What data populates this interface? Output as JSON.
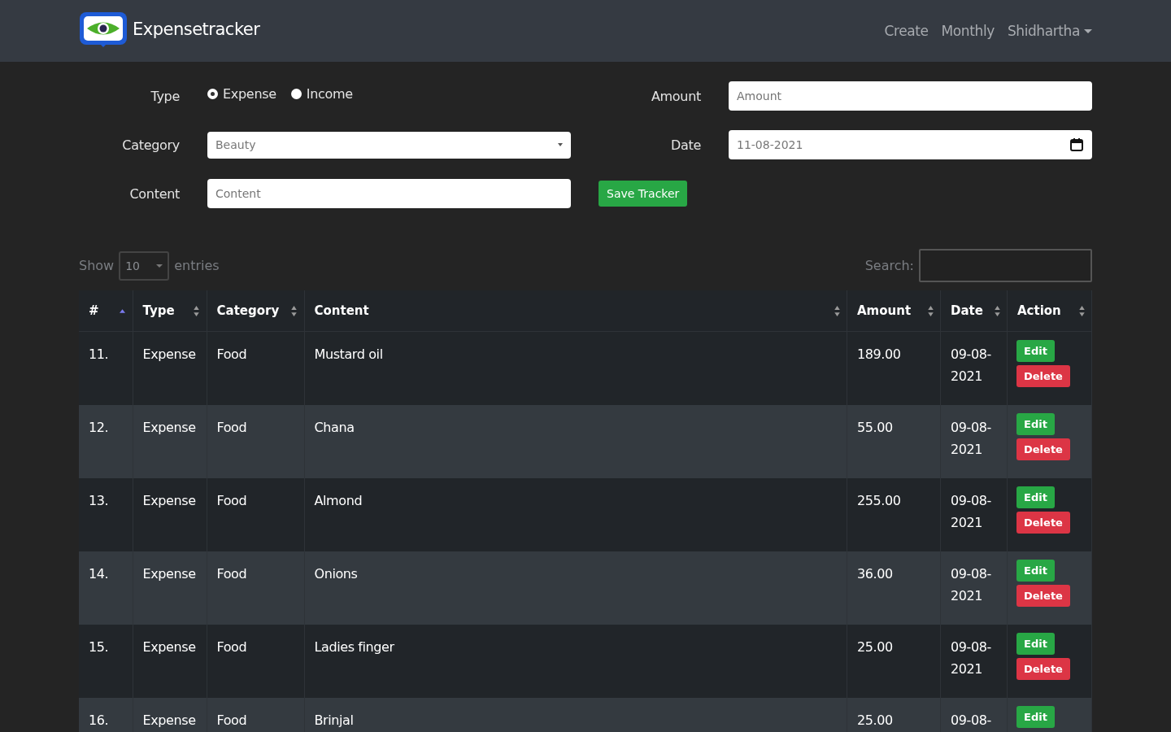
{
  "navbar": {
    "brand": "Expensetracker",
    "links": [
      {
        "label": "Create",
        "dropdown": false
      },
      {
        "label": "Monthly",
        "dropdown": false
      },
      {
        "label": "Shidhartha",
        "dropdown": true
      }
    ]
  },
  "form": {
    "type_label": "Type",
    "type_options": [
      {
        "label": "Expense",
        "selected": true
      },
      {
        "label": "Income",
        "selected": false
      }
    ],
    "category_label": "Category",
    "category_value": "Beauty",
    "content_label": "Content",
    "content_placeholder": "Content",
    "amount_label": "Amount",
    "amount_placeholder": "Amount",
    "date_label": "Date",
    "date_value": "11-08-2021",
    "save_button": "Save Tracker"
  },
  "table_controls": {
    "show_label": "Show",
    "page_size": "10",
    "entries_label": "entries",
    "search_label": "Search:"
  },
  "table": {
    "columns": [
      {
        "label": "#",
        "sorted": true
      },
      {
        "label": "Type",
        "sorted": false
      },
      {
        "label": "Category",
        "sorted": false
      },
      {
        "label": "Content",
        "sorted": false
      },
      {
        "label": "Amount",
        "sorted": false
      },
      {
        "label": "Date",
        "sorted": false
      },
      {
        "label": "Action",
        "sorted": false
      }
    ],
    "rows": [
      {
        "no": "11.",
        "type": "Expense",
        "category": "Food",
        "content": "Mustard oil",
        "amount": "189.00",
        "date": "09-08-2021",
        "actions": [
          {
            "label": "Edit",
            "kind": "edit"
          },
          {
            "label": "Delete",
            "kind": "delete"
          }
        ]
      },
      {
        "no": "12.",
        "type": "Expense",
        "category": "Food",
        "content": "Chana",
        "amount": "55.00",
        "date": "09-08-2021",
        "actions": [
          {
            "label": "Edit",
            "kind": "edit"
          },
          {
            "label": "Delete",
            "kind": "delete"
          }
        ]
      },
      {
        "no": "13.",
        "type": "Expense",
        "category": "Food",
        "content": "Almond",
        "amount": "255.00",
        "date": "09-08-2021",
        "actions": [
          {
            "label": "Edit",
            "kind": "edit"
          },
          {
            "label": "Delete",
            "kind": "delete"
          }
        ]
      },
      {
        "no": "14.",
        "type": "Expense",
        "category": "Food",
        "content": "Onions",
        "amount": "36.00",
        "date": "09-08-2021",
        "actions": [
          {
            "label": "Edit",
            "kind": "edit"
          },
          {
            "label": "Delete",
            "kind": "delete"
          }
        ]
      },
      {
        "no": "15.",
        "type": "Expense",
        "category": "Food",
        "content": "Ladies finger",
        "amount": "25.00",
        "date": "09-08-2021",
        "actions": [
          {
            "label": "Edit",
            "kind": "edit"
          },
          {
            "label": "Delete",
            "kind": "delete"
          }
        ]
      },
      {
        "no": "16.",
        "type": "Expense",
        "category": "Food",
        "content": "Brinjal",
        "amount": "25.00",
        "date": "09-08-",
        "actions": [
          {
            "label": "Edit",
            "kind": "edit"
          }
        ]
      }
    ]
  }
}
